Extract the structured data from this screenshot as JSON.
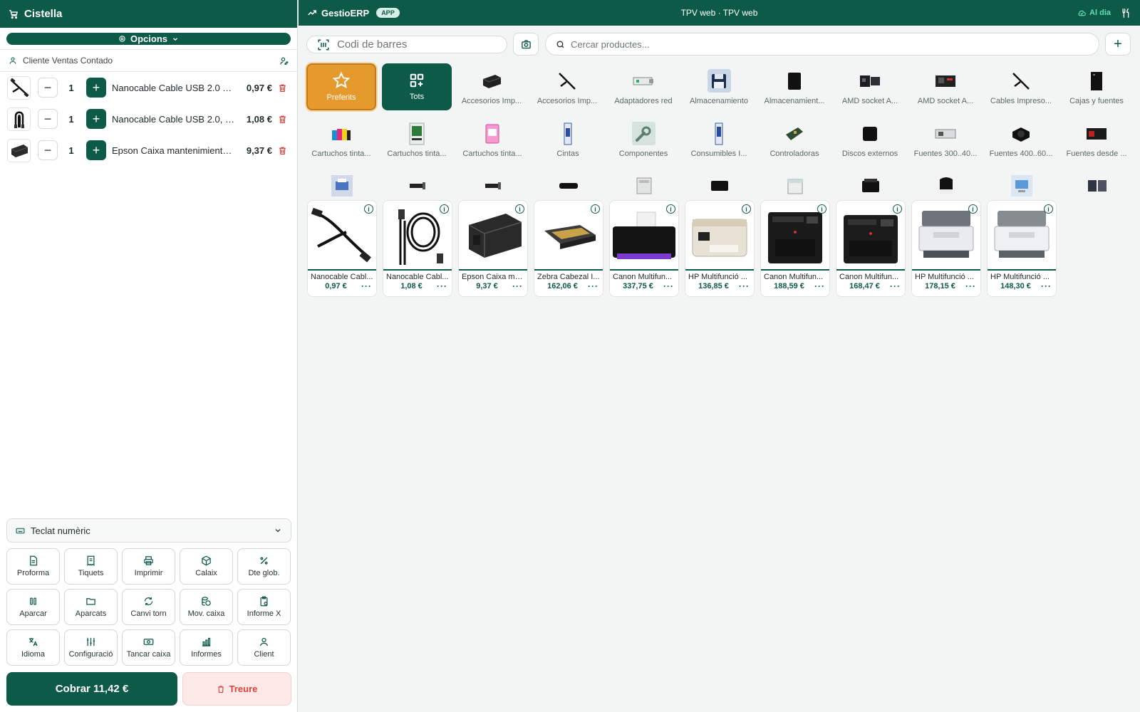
{
  "cart": {
    "title": "Cistella",
    "options_label": "Opcions",
    "customer": "Cliente Ventas Contado",
    "lines": [
      {
        "qty": "1",
        "name": "Nanocable Cable USB 2.0 Ti...",
        "price": "0,97 €"
      },
      {
        "qty": "1",
        "name": "Nanocable Cable USB 2.0, ti...",
        "price": "1,08 €"
      },
      {
        "qty": "1",
        "name": "Epson Caixa mantenimiento ...",
        "price": "9,37 €"
      }
    ],
    "numpad_label": "Teclat numèric",
    "actions": [
      {
        "label": "Proforma",
        "icon": "document-icon"
      },
      {
        "label": "Tiquets",
        "icon": "receipt-icon"
      },
      {
        "label": "Imprimir",
        "icon": "printer-icon"
      },
      {
        "label": "Calaix",
        "icon": "box-icon"
      },
      {
        "label": "Dte glob.",
        "icon": "percent-icon"
      },
      {
        "label": "Aparcar",
        "icon": "pause-icon"
      },
      {
        "label": "Aparcats",
        "icon": "folder-icon"
      },
      {
        "label": "Canvi torn",
        "icon": "refresh-icon"
      },
      {
        "label": "Mov. caixa",
        "icon": "coins-icon"
      },
      {
        "label": "Informe X",
        "icon": "clipboard-icon"
      },
      {
        "label": "Idioma",
        "icon": "language-icon"
      },
      {
        "label": "Configuració",
        "icon": "sliders-icon"
      },
      {
        "label": "Tancar caixa",
        "icon": "cash-icon"
      },
      {
        "label": "Informes",
        "icon": "bar-chart-icon"
      },
      {
        "label": "Client",
        "icon": "user-icon"
      }
    ],
    "charge_label": "Cobrar 11,42 €",
    "remove_label": "Treure"
  },
  "topbar": {
    "brand": "GestioERP",
    "badge": "APP",
    "title": "TPV web · TPV web",
    "status": "Al dia"
  },
  "search": {
    "barcode_placeholder": "Codi de barres",
    "product_placeholder": "Cercar productes..."
  },
  "special_tiles": {
    "favorites": "Preferits",
    "all": "Tots"
  },
  "categories_row1": [
    "Accesorios Imp...",
    "Accesorios Imp...",
    "Adaptadores red",
    "Almacenamiento",
    "Almacenamient...",
    "AMD socket A...",
    "AMD socket A...",
    "Cables Impreso...",
    "Cajas y fuentes"
  ],
  "categories_row2": [
    "Cartuchos tinta...",
    "Cartuchos tinta...",
    "Cartuchos tinta...",
    "Cintas",
    "Componentes",
    "Consumibles I...",
    "Controladoras",
    "Discos externos",
    "Fuentes 300..40...",
    "Fuentes 400..60...",
    "Fuentes desde ..."
  ],
  "products": [
    {
      "name": "Nanocable Cabl...",
      "price": "0,97 €"
    },
    {
      "name": "Nanocable Cabl...",
      "price": "1,08 €"
    },
    {
      "name": "Epson Caixa ma...",
      "price": "9,37 €"
    },
    {
      "name": "Zebra Cabezal I...",
      "price": "162,06 €"
    },
    {
      "name": "Canon Multifun...",
      "price": "337,75 €"
    },
    {
      "name": "HP Multifunció ...",
      "price": "136,85 €"
    },
    {
      "name": "Canon Multifun...",
      "price": "188,59 €"
    },
    {
      "name": "Canon Multifun...",
      "price": "168,47 €"
    },
    {
      "name": "HP Multifunció ...",
      "price": "178,15 €"
    },
    {
      "name": "HP Multifunció ...",
      "price": "148,30 €"
    }
  ],
  "product_more": "···",
  "colors": {
    "primary": "#0e5a48",
    "favorite": "#e59a2d",
    "danger": "#d9433a",
    "status": "#5fe0b7"
  }
}
